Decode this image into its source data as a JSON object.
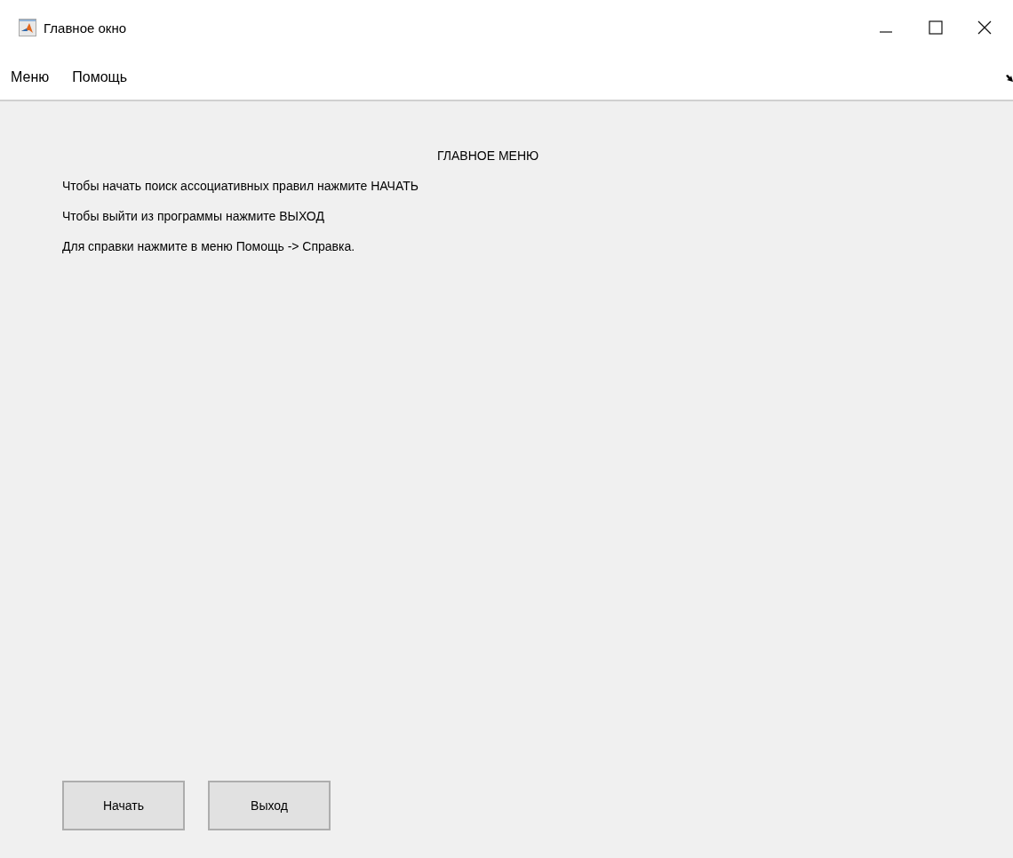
{
  "window": {
    "title": "Главное окно"
  },
  "menu": [
    "Меню",
    "Помощь"
  ],
  "heading": "ГЛАВНОЕ МЕНЮ",
  "lines": [
    "Чтобы начать поиск ассоциативных правил нажмите НАЧАТЬ",
    "Чтобы выйти из программы нажмите ВЫХОД",
    "Для справки нажмите в меню Помощь -> Справка."
  ],
  "buttons": [
    "Начать",
    "Выход"
  ]
}
